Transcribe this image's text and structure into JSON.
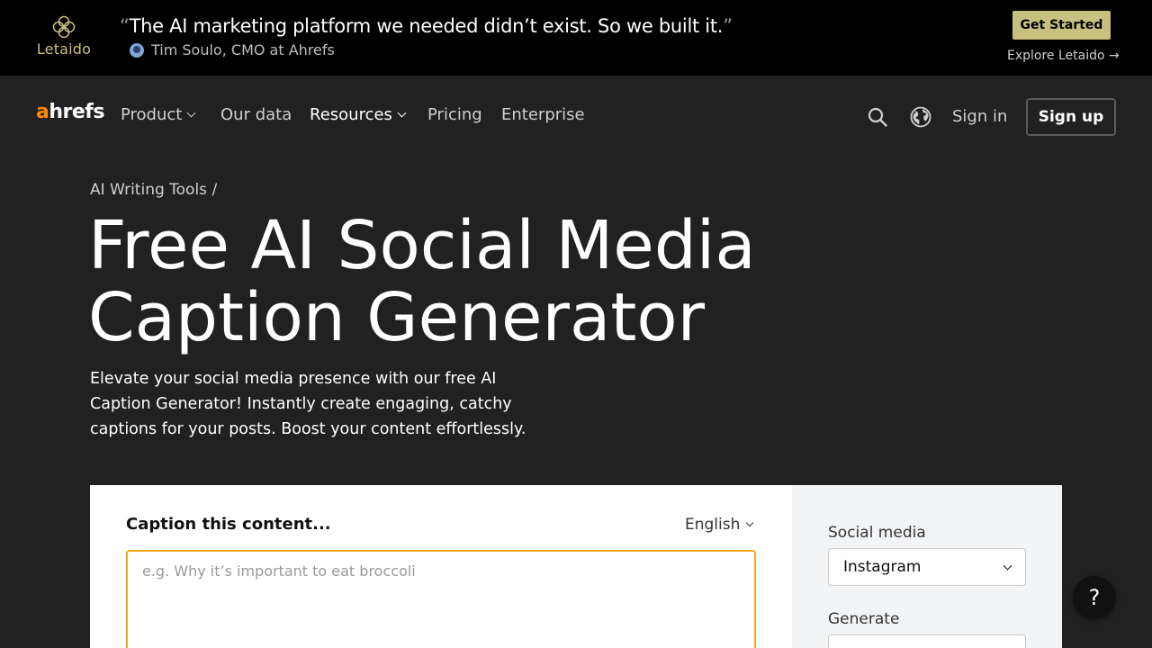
{
  "banner": {
    "brand": "Letaido",
    "quote_open": "“",
    "quote": "The AI marketing platform we needed didn’t exist. So we built it.",
    "quote_close": "”",
    "author": "Tim Soulo, CMO at Ahrefs",
    "cta_label": "Get Started",
    "explore_label": "Explore Letaido →",
    "accent_color": "#c8c07e"
  },
  "header": {
    "logo_a": "a",
    "logo_rest": "hrefs",
    "logo_accent": "#ff8800",
    "nav": [
      {
        "label": "Product",
        "has_dropdown": true
      },
      {
        "label": "Our data",
        "has_dropdown": false
      },
      {
        "label": "Resources",
        "has_dropdown": true
      },
      {
        "label": "Pricing",
        "has_dropdown": false
      },
      {
        "label": "Enterprise",
        "has_dropdown": false
      }
    ],
    "sign_in": "Sign in",
    "sign_up": "Sign up",
    "icons": [
      "search-icon",
      "globe-icon"
    ]
  },
  "hero": {
    "breadcrumb": "AI Writing Tools /",
    "title_line1": "Free AI Social Media",
    "title_line2": "Caption Generator",
    "description": "Elevate your social media presence with our free AI Caption Generator! Instantly create engaging, catchy captions for your posts. Boost your content effortlessly."
  },
  "tool": {
    "caption_label": "Caption this content...",
    "language": "English",
    "input_value": "",
    "input_placeholder": "e.g. Why it’s important to eat broccoli",
    "input_border_color": "#f5a623",
    "social_label": "Social media",
    "social_value": "Instagram",
    "generate_label": "Generate"
  },
  "help": {
    "label": "?"
  }
}
